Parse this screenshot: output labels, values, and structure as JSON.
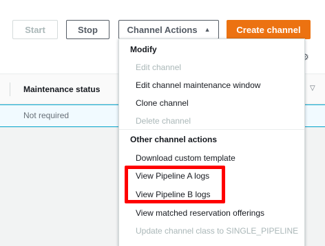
{
  "toolbar": {
    "start_label": "Start",
    "stop_label": "Stop",
    "channel_actions_label": "Channel Actions",
    "channel_actions_caret": "▲",
    "create_label": "Create channel",
    "gear_icon": "gear-icon"
  },
  "table": {
    "column_header": "Maintenance status",
    "sort_icon": "▽",
    "row_value": "Not required"
  },
  "menu": {
    "modify_label": "Modify",
    "modify_items": [
      {
        "label": "Edit channel",
        "enabled": false
      },
      {
        "label": "Edit channel maintenance window",
        "enabled": true
      },
      {
        "label": "Clone channel",
        "enabled": true
      },
      {
        "label": "Delete channel",
        "enabled": false
      }
    ],
    "other_label": "Other channel actions",
    "other_items": [
      {
        "label": "Download custom template",
        "enabled": true
      },
      {
        "label": "View Pipeline A logs",
        "enabled": true
      },
      {
        "label": "View Pipeline B logs",
        "enabled": true
      },
      {
        "label": "View matched reservation offerings",
        "enabled": true
      },
      {
        "label": "Update channel class to SINGLE_PIPELINE",
        "enabled": false
      }
    ]
  },
  "colors": {
    "accent": "#ec7211",
    "highlight": "#ff0000",
    "selected_row": "#f1faff"
  }
}
